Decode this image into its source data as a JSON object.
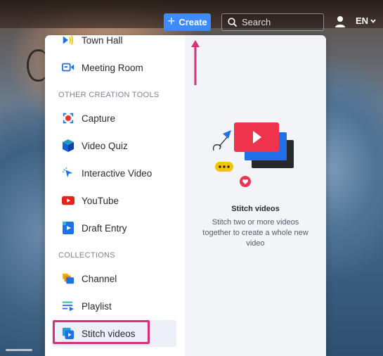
{
  "topbar": {
    "create_label": "Create",
    "search_placeholder": "Search",
    "language": "EN"
  },
  "menu": {
    "items_top": [
      {
        "label": "Town Hall",
        "icon": "town-hall-icon"
      },
      {
        "label": "Meeting Room",
        "icon": "meeting-room-icon"
      }
    ],
    "section_tools": "OTHER CREATION TOOLS",
    "tools": [
      {
        "label": "Capture",
        "icon": "capture-icon"
      },
      {
        "label": "Video Quiz",
        "icon": "video-quiz-icon"
      },
      {
        "label": "Interactive Video",
        "icon": "interactive-video-icon"
      },
      {
        "label": "YouTube",
        "icon": "youtube-icon"
      },
      {
        "label": "Draft Entry",
        "icon": "draft-entry-icon"
      }
    ],
    "section_collections": "COLLECTIONS",
    "collections": [
      {
        "label": "Channel",
        "icon": "channel-icon"
      },
      {
        "label": "Playlist",
        "icon": "playlist-icon"
      },
      {
        "label": "Stitch videos",
        "icon": "stitch-videos-icon",
        "selected": true
      }
    ]
  },
  "preview": {
    "title": "Stitch videos",
    "description": "Stitch two or more videos together to create a whole new video"
  },
  "colors": {
    "accent": "#3d8bfd",
    "highlight": "#d6307a",
    "preview_bg": "#f2f4f8"
  }
}
